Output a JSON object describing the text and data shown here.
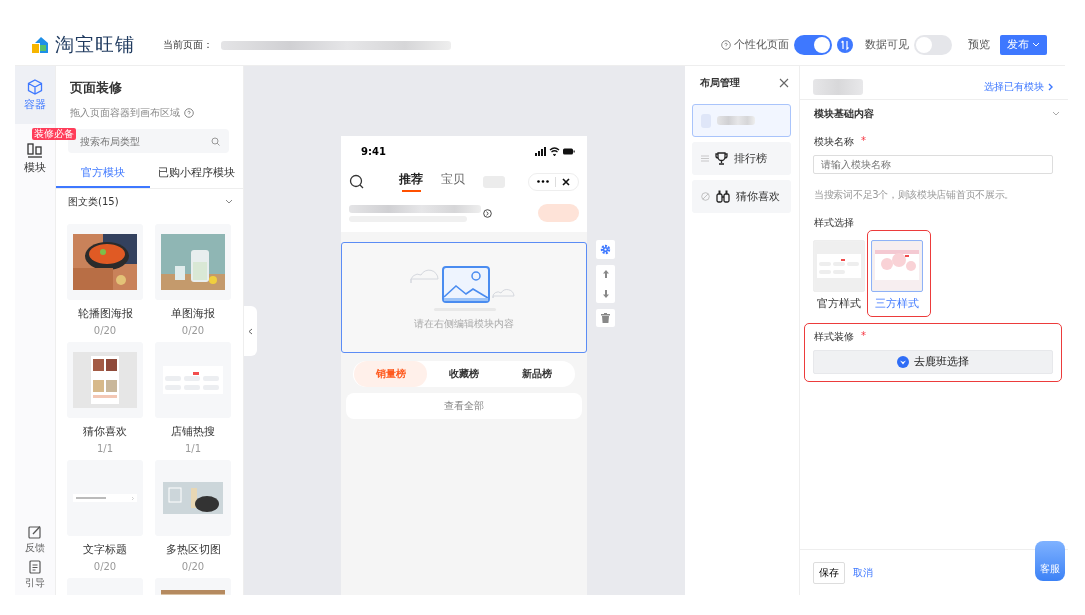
{
  "header": {
    "logo_text": "淘宝旺铺",
    "current_page_label": "当前页面：",
    "personalize": {
      "label": "个性化页面",
      "on": true
    },
    "data_visible": {
      "label": "数据可见",
      "on": false
    },
    "preview": "预览",
    "publish": "发布"
  },
  "rail": {
    "items": [
      {
        "label": "容器",
        "kind": "cube",
        "selected": true
      },
      {
        "label": "模块",
        "kind": "blocks",
        "selected": false,
        "badge": "装修必备"
      }
    ],
    "bottom": [
      {
        "label": "反馈",
        "kind": "edit"
      },
      {
        "label": "引导",
        "kind": "doc"
      }
    ]
  },
  "module_panel": {
    "title": "页面装修",
    "subtitle": "拖入页面容器到画布区域",
    "search": {
      "placeholder": "搜索布局类型"
    },
    "tabs": [
      {
        "label": "官方模块",
        "selected": true
      },
      {
        "label": "已购小程序模块",
        "selected": false
      }
    ],
    "category": {
      "label": "图文类(15)",
      "expanded": true
    },
    "cards": [
      {
        "name": "轮播图海报",
        "count": "0/20",
        "kind": "soup"
      },
      {
        "name": "单图海报",
        "count": "0/20",
        "kind": "jug"
      },
      {
        "name": "猜你喜欢",
        "count": "1/1",
        "kind": "grid"
      },
      {
        "name": "店铺热搜",
        "count": "1/1",
        "kind": "tags"
      },
      {
        "name": "文字标题",
        "count": "0/20",
        "kind": "titlebar"
      },
      {
        "name": "多热区切图",
        "count": "0/20",
        "kind": "pot"
      },
      {
        "kind": "blank"
      },
      {
        "kind": "strip"
      }
    ]
  },
  "phone": {
    "time": "9:41",
    "tabs": [
      {
        "label": "推荐",
        "selected": true
      },
      {
        "label": "宝贝",
        "selected": false
      }
    ],
    "module_hint": "请在右侧编辑模块内容",
    "rank_tabs": [
      {
        "label": "销量榜",
        "selected": true
      },
      {
        "label": "收藏榜",
        "selected": false
      },
      {
        "label": "新品榜",
        "selected": false
      }
    ],
    "view_all": "查看全部"
  },
  "layout_panel": {
    "title": "布局管理",
    "items": [
      {
        "kind": "blurred",
        "selected": true
      },
      {
        "label": "排行榜",
        "kind": "trophy",
        "selected": false
      },
      {
        "label": "猜你喜欢",
        "kind": "binoculars",
        "selected": false
      }
    ]
  },
  "props": {
    "link": "选择已有模块",
    "section": {
      "label": "模块基础内容",
      "expanded": true
    },
    "name_field": {
      "label": "模块名称",
      "required_mark": "*",
      "placeholder": "请输入模块名称"
    },
    "hint": "当搜索词不足3个，则该模块店铺首页不展示。",
    "style_label": "样式选择",
    "styles": [
      {
        "label": "官方样式",
        "selected": false,
        "annotated": false
      },
      {
        "label": "三方样式",
        "selected": true,
        "annotated": true
      }
    ],
    "decor": {
      "label": "样式装修",
      "required_mark": "*",
      "button": "去鹿班选择",
      "annotated": true
    },
    "save": "保存",
    "cancel": "取消",
    "service": "客服"
  }
}
